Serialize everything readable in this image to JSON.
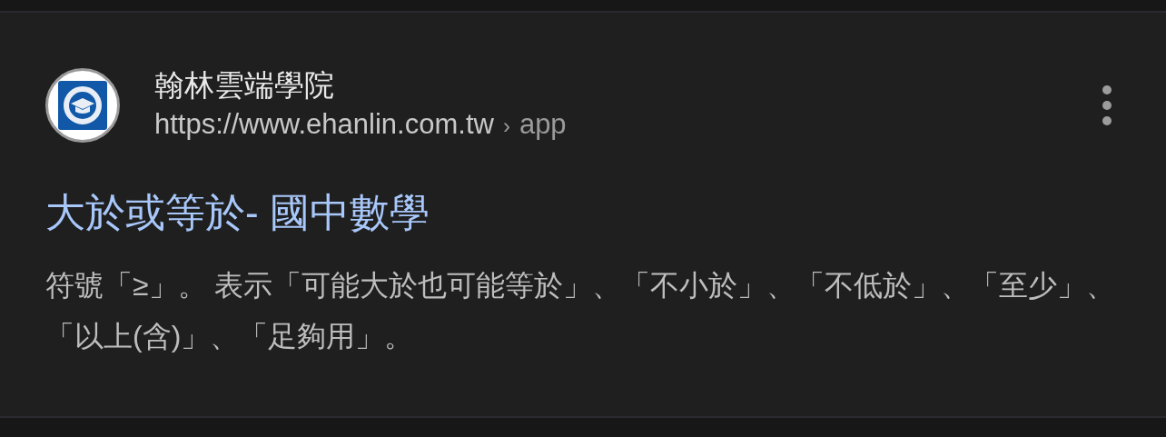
{
  "result": {
    "site_name": "翰林雲端學院",
    "url": "https://www.ehanlin.com.tw",
    "breadcrumb_separator": "›",
    "breadcrumb": "app",
    "title": "大於或等於- 國中數學",
    "snippet": "符號「≥」。 表示「可能大於也可能等於」、「不小於」、「不低於」、「至少」、「以上(含)」、「足夠用」。"
  }
}
